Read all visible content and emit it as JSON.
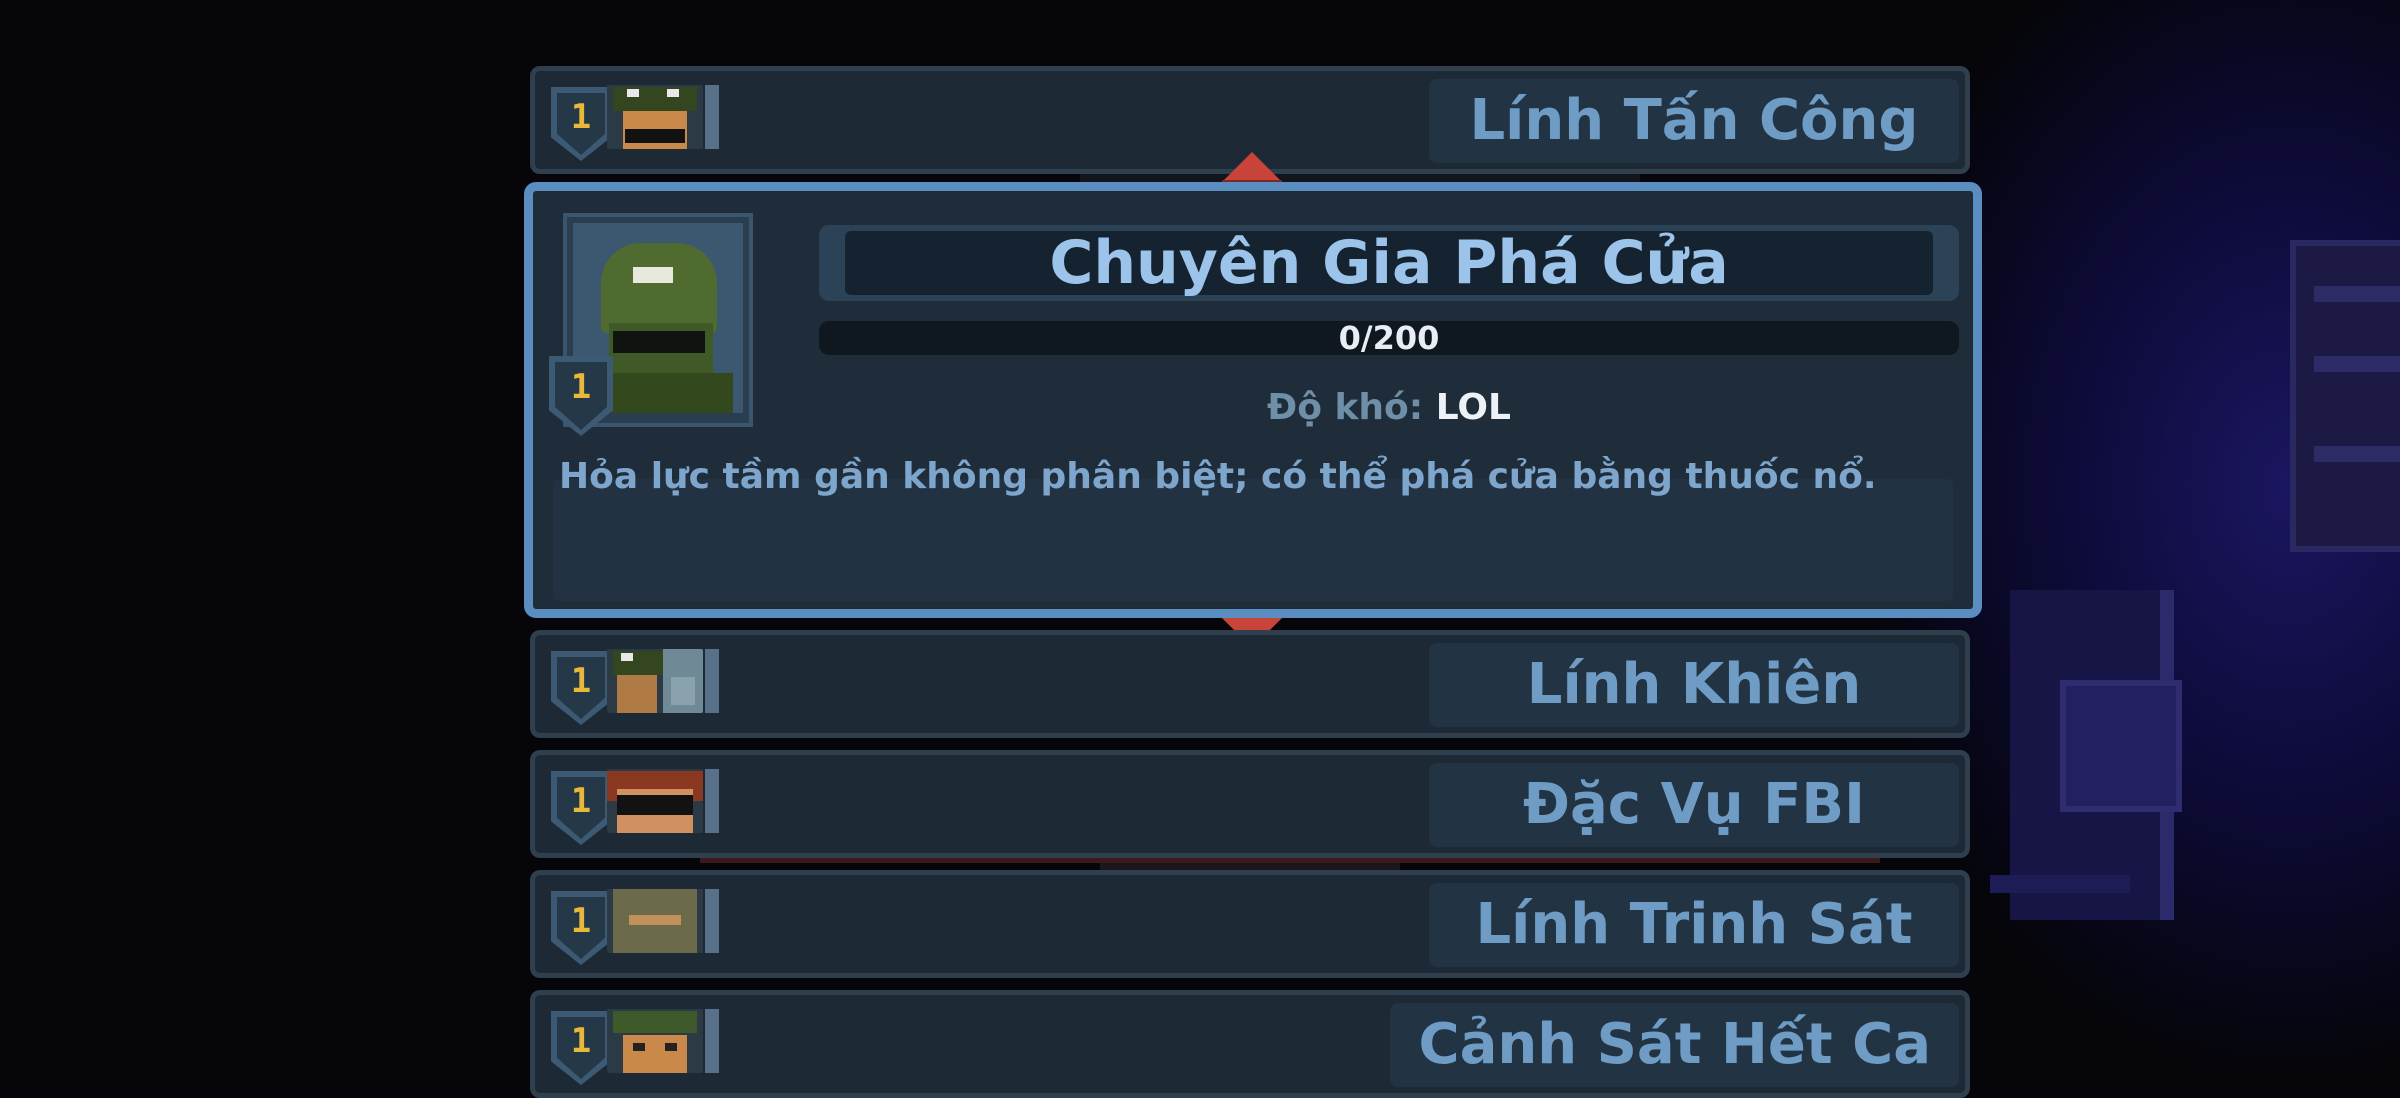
{
  "roster": {
    "above": [
      {
        "level": "1",
        "name": "Lính Tấn Công"
      }
    ],
    "selected": {
      "level": "1",
      "title": "Chuyên Gia Phá Cửa",
      "progress_text": "0/200",
      "progress_fraction": 0,
      "difficulty_label": "Độ khó:",
      "difficulty_value": "LOL",
      "description": "Hỏa lực tầm gần không phân biệt; có thể phá cửa bằng thuốc nổ."
    },
    "below": [
      {
        "level": "1",
        "name": "Lính Khiên"
      },
      {
        "level": "1",
        "name": "Đặc Vụ FBI"
      },
      {
        "level": "1",
        "name": "Lính Trinh Sát"
      },
      {
        "level": "1",
        "name": "Cảnh Sát Hết Ca"
      }
    ]
  },
  "icons": {
    "scroll_up": "triangle-up-icon",
    "scroll_down": "triangle-down-icon",
    "level_badge": "shield-icon"
  },
  "colors": {
    "accent": "#5a8ec0",
    "level": "#e9b83a",
    "arrow": "#c8443a"
  }
}
